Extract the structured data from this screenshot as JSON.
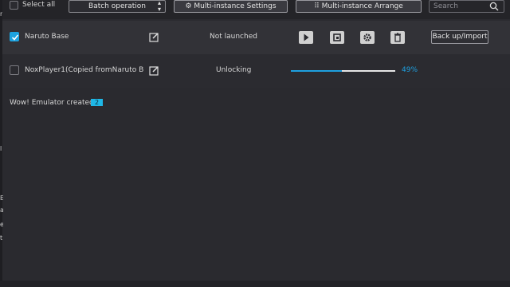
{
  "colors": {
    "accent": "#1da3e0",
    "badge": "#1fb7e6",
    "background": "#2a2a2f",
    "row_highlight": "#323237"
  },
  "toolbar": {
    "select_all_label": "Select all",
    "batch_label": "Batch operation",
    "settings_label": "Multi-instance Settings",
    "arrange_label": "Multi-instance Arrange",
    "search_placeholder": "Search"
  },
  "instances": [
    {
      "name": "Naruto Base",
      "checked": true,
      "status": "Not launched",
      "backup_label": "Back up/Import",
      "actions": [
        "play-icon",
        "shortcut-icon",
        "gear-icon",
        "trash-icon"
      ]
    },
    {
      "name": "NoxPlayer1(Copied fromNaruto B",
      "checked": false,
      "status": "Unlocking",
      "progress": 0.49,
      "progress_text": "49%"
    }
  ],
  "notice": {
    "text": "Wow! Emulator created:",
    "count": "2"
  },
  "left_strip_chars": [
    "r",
    "l",
    "E",
    "a",
    "e",
    "t"
  ]
}
